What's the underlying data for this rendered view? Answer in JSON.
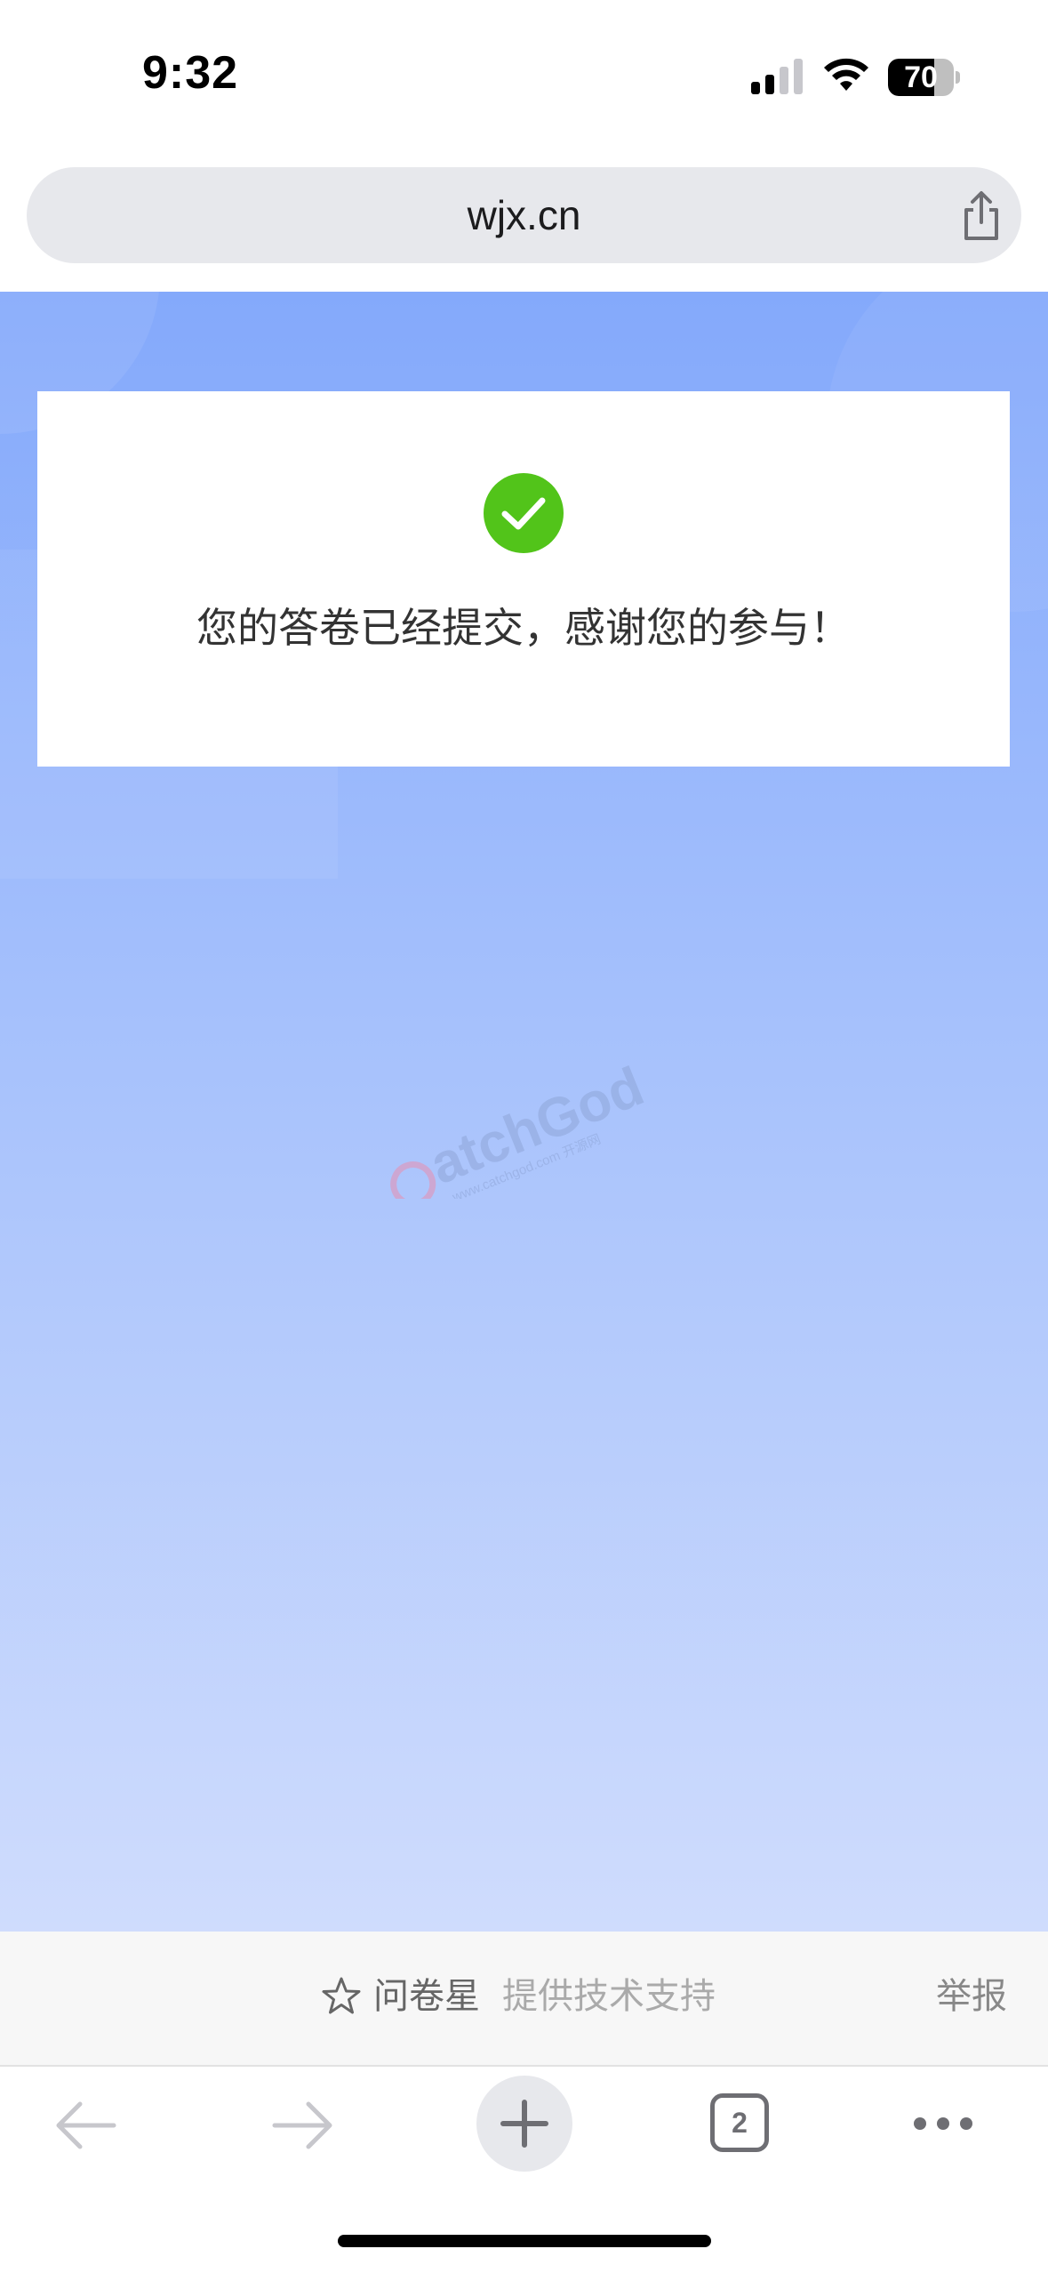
{
  "status_bar": {
    "time": "9:32",
    "battery_level": 70,
    "battery_text": "70",
    "signal_bars_active": 2,
    "signal_bars_total": 4
  },
  "address_bar": {
    "url": "wjx.cn",
    "share_icon": "share-icon"
  },
  "page": {
    "background_top": "#84a9fb",
    "background_bottom": "#cfdcfd",
    "success_icon": "check-circle-icon",
    "success_color": "#52c41a",
    "message": "您的答卷已经提交，感谢您的参与！",
    "watermark": {
      "logo": "CatchGod",
      "url": "www.catchgod.com 开源网"
    }
  },
  "footer": {
    "star_icon": "star-icon",
    "brand": "问卷星",
    "support_text": "提供技术支持",
    "report": "举报"
  },
  "toolbar": {
    "back_icon": "back-arrow-icon",
    "forward_icon": "forward-arrow-icon",
    "new_tab_icon": "plus-icon",
    "tab_count": "2",
    "more_icon": "more-dots-icon"
  }
}
